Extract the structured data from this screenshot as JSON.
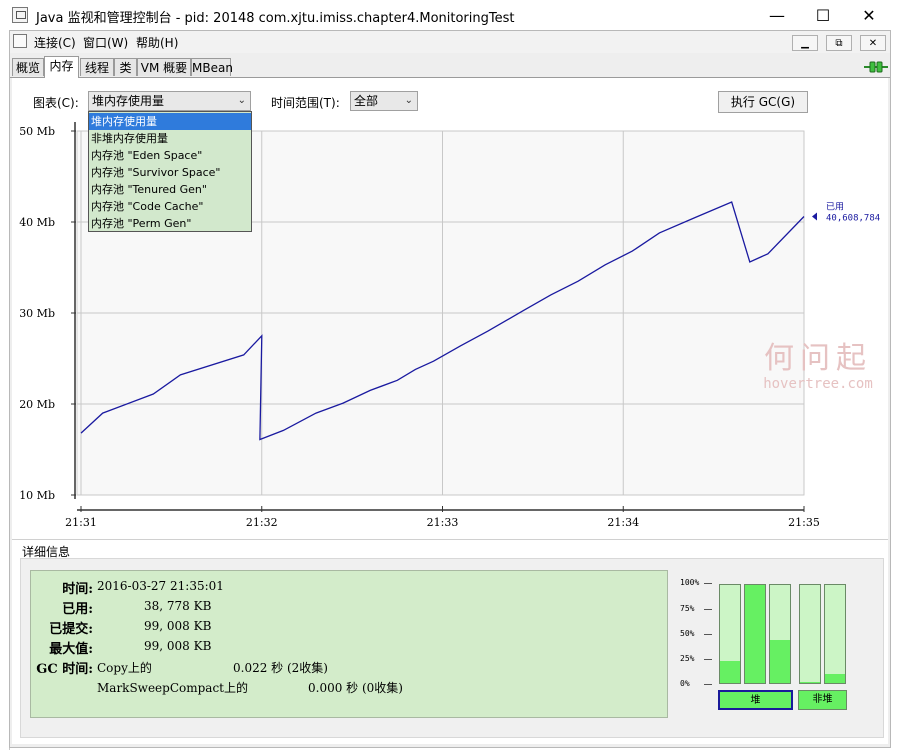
{
  "window": {
    "title": "Java 监视和管理控制台 - pid: 20148 com.xjtu.imiss.chapter4.MonitoringTest",
    "minimize": "—",
    "maximize": "☐",
    "close": "✕"
  },
  "menu": {
    "items": [
      {
        "label": "连接(C)"
      },
      {
        "label": "窗口(W)"
      },
      {
        "label": "帮助(H)"
      }
    ],
    "mdi_buttons": [
      "▁",
      "⧉",
      "✕"
    ]
  },
  "tabs": [
    {
      "label": "概览"
    },
    {
      "label": "内存"
    },
    {
      "label": "线程"
    },
    {
      "label": "类"
    },
    {
      "label": "VM 概要"
    },
    {
      "label": "MBean"
    }
  ],
  "active_tab": "内存",
  "controls": {
    "chart_label": "图表(C):",
    "chart_value": "堆内存使用量",
    "time_range_label": "时间范围(T):",
    "time_range_value": "全部",
    "gc_button": "执行 GC(G)"
  },
  "chart_dropdown_options": [
    "堆内存使用量",
    "非堆内存使用量",
    "内存池 \"Eden Space\"",
    "内存池 \"Survivor Space\"",
    "内存池 \"Tenured Gen\"",
    "内存池 \"Code Cache\"",
    "内存池 \"Perm Gen\""
  ],
  "chart_data": {
    "type": "line",
    "ylim": [
      10,
      50
    ],
    "yticks": [
      "10 Mb",
      "20 Mb",
      "30 Mb",
      "40 Mb",
      "50 Mb"
    ],
    "xticks": [
      "21:31",
      "21:32",
      "21:33",
      "21:34",
      "21:35"
    ],
    "xlim": [
      0,
      4
    ],
    "grid": true,
    "series": [
      {
        "name": "已用",
        "color": "#1a1aa0",
        "x": [
          0.0,
          0.12,
          0.4,
          0.55,
          0.9,
          1.0,
          0.99,
          1.12,
          1.3,
          1.45,
          1.6,
          1.75,
          1.85,
          1.95,
          2.1,
          2.25,
          2.45,
          2.6,
          2.75,
          2.9,
          3.05,
          3.2,
          3.4,
          3.6,
          3.7,
          3.8,
          4.0
        ],
        "values": [
          16.8,
          19.0,
          21.1,
          23.2,
          25.4,
          27.5,
          16.1,
          17.1,
          19.0,
          20.1,
          21.5,
          22.6,
          23.8,
          24.7,
          26.4,
          28.0,
          30.3,
          32.0,
          33.5,
          35.3,
          36.8,
          38.8,
          40.5,
          42.2,
          35.6,
          36.5,
          40.6
        ]
      }
    ],
    "last_value_label": "已用",
    "last_value": "40,608,784"
  },
  "details": {
    "section_title": "详细信息",
    "rows": [
      {
        "key": "时间:",
        "value": "2016-03-27 21:35:01"
      },
      {
        "key": "已用:",
        "value": "38, 778 KB"
      },
      {
        "key": "已提交:",
        "value": "99, 008 KB"
      },
      {
        "key": "最大值:",
        "value": "99, 008 KB"
      }
    ],
    "gc_key": "GC 时间:",
    "gc_lines": [
      {
        "name": "Copy上的",
        "value": "0.022 秒 (2收集)"
      },
      {
        "name": "MarkSweepCompact上的",
        "value": "0.000 秒 (0收集)"
      }
    ]
  },
  "pool_bars": {
    "scale": [
      "100%",
      "75%",
      "50%",
      "25%",
      "0%"
    ],
    "heap_label": "堆",
    "nonheap_label": "非堆",
    "heap_fills": [
      0.22,
      1.0,
      0.44
    ],
    "nonheap_fills": [
      0.01,
      0.09
    ]
  },
  "watermark": {
    "cn": "何问起",
    "en": "hovertree.com"
  }
}
